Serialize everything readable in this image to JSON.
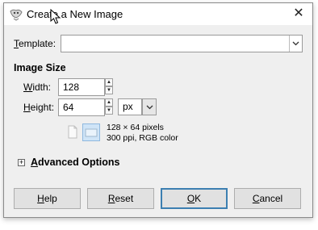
{
  "window": {
    "title": "Create a New Image"
  },
  "template": {
    "label": "Template:",
    "value": ""
  },
  "image_size": {
    "section_title": "Image Size",
    "width_label": "Width:",
    "width_value": "128",
    "height_label": "Height:",
    "height_value": "64",
    "unit": "px",
    "info_line1": "128 × 64 pixels",
    "info_line2": "300 ppi, RGB color"
  },
  "advanced": {
    "label": "Advanced Options",
    "expander_symbol": "+"
  },
  "buttons": {
    "help": "Help",
    "reset": "Reset",
    "ok": "OK",
    "cancel": "Cancel"
  },
  "icons": {
    "close": "✕",
    "combo_arrow": "⌄"
  }
}
